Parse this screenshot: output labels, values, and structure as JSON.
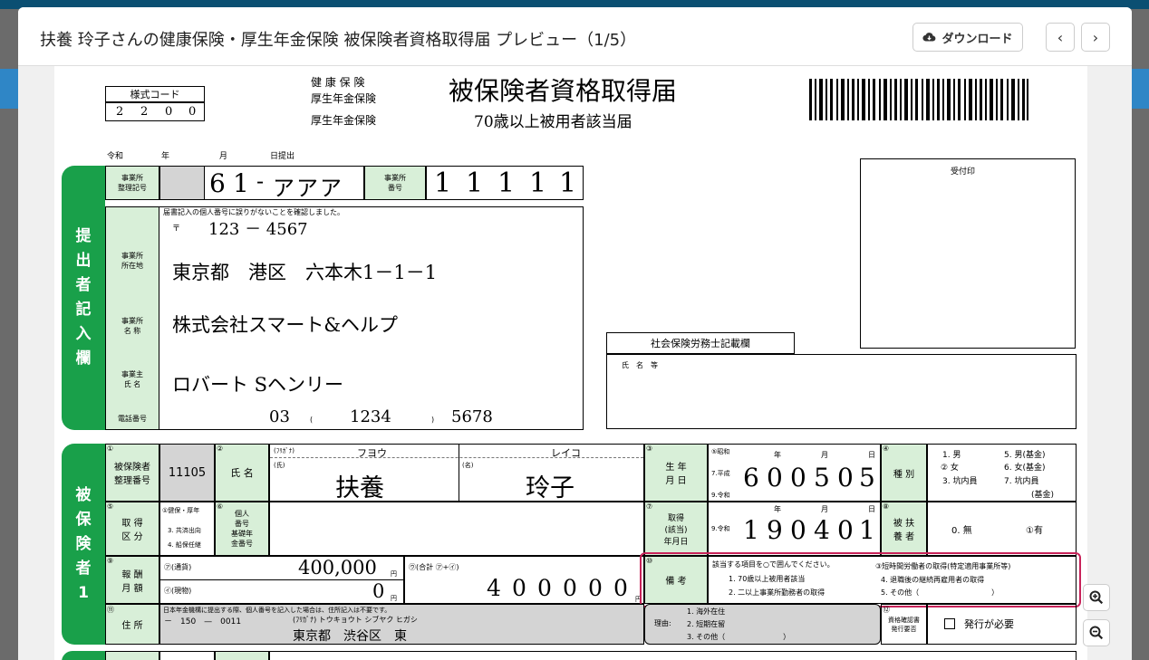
{
  "modal": {
    "title": "扶養 玲子さんの健康保険・厚生年金保険 被保険者資格取得届 プレビュー（1/5）",
    "download_label": "ダウンロード",
    "prev_label": "‹",
    "next_label": "›"
  },
  "form": {
    "style_code_label": "様式コード",
    "style_code": [
      "2",
      "2",
      "0",
      "0"
    ],
    "insurance_lines": [
      "健 康 保 険",
      "厚生年金保険",
      "厚生年金保険"
    ],
    "title_main": "被保険者資格取得届",
    "title_sub": "70歳以上被用者該当届",
    "date_labels": [
      "令和",
      "年",
      "月",
      "日提出"
    ],
    "receipt_stamp": "受付印",
    "submitter_side": "提出者記入欄",
    "office_reg_label": "事業所\n整理記号",
    "office_reg_value": [
      "6",
      "1",
      "-",
      "ア",
      "ア",
      "ア"
    ],
    "office_no_label": "事業所\n番号",
    "office_no_value": [
      "1",
      "1",
      "1",
      "1",
      "1"
    ],
    "confirm_text": "届書記入の個人番号に誤りがないことを確認しました。",
    "postal_mark": "〒",
    "postal_code": "123 － 4567",
    "office_location_label": "事業所\n所在地",
    "office_address": "東京都　港区　六本木1－1－1",
    "office_name_label": "事業所\n名 称",
    "office_name": "株式会社スマート&ヘルプ",
    "owner_label": "事業主\n氏 名",
    "owner_name": "ロバート Sヘンリー",
    "phone_label": "電話番号",
    "phone": [
      "03",
      "(",
      "1234",
      ")",
      "5678"
    ],
    "sharoushi_label": "社会保険労務士記載欄",
    "sharoushi_name_label": "氏　名　等",
    "insured_side": "被保険者１",
    "f1_num": "①",
    "f1_label": "被保険者\n整理番号",
    "f1_value": "11105",
    "f2_num": "②",
    "f2_label": "氏 名",
    "furigana_label": "(ﾌﾘｶﾞﾅ)",
    "family_label": "(氏)",
    "given_label": "(名)",
    "furigana_family": "フヨウ",
    "furigana_given": "レイコ",
    "family_name": "扶養",
    "given_name": "玲子",
    "f3_num": "③",
    "f3_label": "生 年\n月 日",
    "birth_era": [
      "⑤昭和",
      "7.平成",
      "9.令和"
    ],
    "birth_digits": [
      "6",
      "0",
      "0",
      "5",
      "0",
      "5"
    ],
    "ymd": [
      "年",
      "月",
      "日"
    ],
    "f4_num": "④",
    "f4_label": "種 別",
    "types": [
      "1. 男",
      "5. 男(基金)",
      "② 女",
      "6. 女(基金)",
      "3. 坑内員",
      "7. 坑内員",
      "(基金)"
    ],
    "f5_num": "⑤",
    "f5_label": "取 得\n区 分",
    "acq_types": [
      "①健保・厚年",
      "3. 共済出向",
      "4. 船保任継"
    ],
    "f6_num": "⑥",
    "f6_label": "個人\n番号\n基礎年\n金番号",
    "f7_num": "⑦",
    "f7_label": "取得\n(該当)\n年月日",
    "acq_era": "9.令和",
    "acq_digits": [
      "1",
      "9",
      "0",
      "4",
      "0",
      "1"
    ],
    "f8_num": "⑧",
    "f8_label": "被 扶\n養 者",
    "dependent_none": "0. 無",
    "dependent_yes": "①有",
    "f9_num": "⑨",
    "f9_label": "報 酬\n月 額",
    "currency_label": "㋐(通貨)",
    "currency_value": "400,000",
    "goods_label": "㋑(現物)",
    "goods_value": "0",
    "yen": "円",
    "total_label": "㋒(合計 ㋐+㋑)",
    "total_digits": [
      "4",
      "0",
      "0",
      "0",
      "0",
      "0"
    ],
    "f10_num": "⑩",
    "f10_label": "備 考",
    "remarks_header": "該当する項目を○で囲んでください。",
    "remarks_items": [
      "1. 70歳以上被用者該当",
      "2. 二以上事業所勤務者の取得",
      "③短時間労働者の取得(特定適用事業所等)",
      "4. 退職後の継続再雇用者の取得",
      "5. その他（　　　　　　　　　　）"
    ],
    "f11_num": "⑪",
    "f11_label": "住 所",
    "address_note": "日本年金機構に提出する際、個人番号を記入した場合は、住所記入は不要です。",
    "address_postal": "－　150　—　0011",
    "address_kana": "(ﾌﾘｶﾞﾅ) トウキョウト シブヤク ヒガシ",
    "address_value": "東京都　渋谷区　東",
    "reason_label": "理由:",
    "reasons": [
      "1. 海外在住",
      "2. 短期在留",
      "3. その他（　　　　　　　　）"
    ],
    "f12_num": "⑫",
    "f12_label": "資格確認書\n発行要否",
    "issue_required": "発行が必要"
  }
}
